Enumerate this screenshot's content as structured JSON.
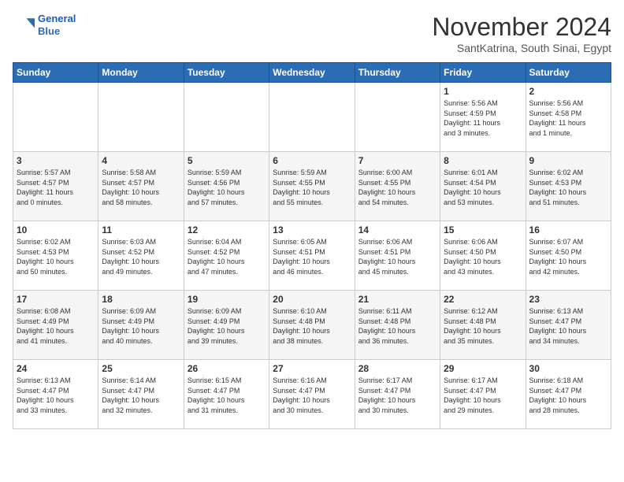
{
  "header": {
    "logo_line1": "General",
    "logo_line2": "Blue",
    "title": "November 2024",
    "subtitle": "SantKatrina, South Sinai, Egypt"
  },
  "weekdays": [
    "Sunday",
    "Monday",
    "Tuesday",
    "Wednesday",
    "Thursday",
    "Friday",
    "Saturday"
  ],
  "weeks": [
    [
      {
        "day": "",
        "info": ""
      },
      {
        "day": "",
        "info": ""
      },
      {
        "day": "",
        "info": ""
      },
      {
        "day": "",
        "info": ""
      },
      {
        "day": "",
        "info": ""
      },
      {
        "day": "1",
        "info": "Sunrise: 5:56 AM\nSunset: 4:59 PM\nDaylight: 11 hours\nand 3 minutes."
      },
      {
        "day": "2",
        "info": "Sunrise: 5:56 AM\nSunset: 4:58 PM\nDaylight: 11 hours\nand 1 minute."
      }
    ],
    [
      {
        "day": "3",
        "info": "Sunrise: 5:57 AM\nSunset: 4:57 PM\nDaylight: 11 hours\nand 0 minutes."
      },
      {
        "day": "4",
        "info": "Sunrise: 5:58 AM\nSunset: 4:57 PM\nDaylight: 10 hours\nand 58 minutes."
      },
      {
        "day": "5",
        "info": "Sunrise: 5:59 AM\nSunset: 4:56 PM\nDaylight: 10 hours\nand 57 minutes."
      },
      {
        "day": "6",
        "info": "Sunrise: 5:59 AM\nSunset: 4:55 PM\nDaylight: 10 hours\nand 55 minutes."
      },
      {
        "day": "7",
        "info": "Sunrise: 6:00 AM\nSunset: 4:55 PM\nDaylight: 10 hours\nand 54 minutes."
      },
      {
        "day": "8",
        "info": "Sunrise: 6:01 AM\nSunset: 4:54 PM\nDaylight: 10 hours\nand 53 minutes."
      },
      {
        "day": "9",
        "info": "Sunrise: 6:02 AM\nSunset: 4:53 PM\nDaylight: 10 hours\nand 51 minutes."
      }
    ],
    [
      {
        "day": "10",
        "info": "Sunrise: 6:02 AM\nSunset: 4:53 PM\nDaylight: 10 hours\nand 50 minutes."
      },
      {
        "day": "11",
        "info": "Sunrise: 6:03 AM\nSunset: 4:52 PM\nDaylight: 10 hours\nand 49 minutes."
      },
      {
        "day": "12",
        "info": "Sunrise: 6:04 AM\nSunset: 4:52 PM\nDaylight: 10 hours\nand 47 minutes."
      },
      {
        "day": "13",
        "info": "Sunrise: 6:05 AM\nSunset: 4:51 PM\nDaylight: 10 hours\nand 46 minutes."
      },
      {
        "day": "14",
        "info": "Sunrise: 6:06 AM\nSunset: 4:51 PM\nDaylight: 10 hours\nand 45 minutes."
      },
      {
        "day": "15",
        "info": "Sunrise: 6:06 AM\nSunset: 4:50 PM\nDaylight: 10 hours\nand 43 minutes."
      },
      {
        "day": "16",
        "info": "Sunrise: 6:07 AM\nSunset: 4:50 PM\nDaylight: 10 hours\nand 42 minutes."
      }
    ],
    [
      {
        "day": "17",
        "info": "Sunrise: 6:08 AM\nSunset: 4:49 PM\nDaylight: 10 hours\nand 41 minutes."
      },
      {
        "day": "18",
        "info": "Sunrise: 6:09 AM\nSunset: 4:49 PM\nDaylight: 10 hours\nand 40 minutes."
      },
      {
        "day": "19",
        "info": "Sunrise: 6:09 AM\nSunset: 4:49 PM\nDaylight: 10 hours\nand 39 minutes."
      },
      {
        "day": "20",
        "info": "Sunrise: 6:10 AM\nSunset: 4:48 PM\nDaylight: 10 hours\nand 38 minutes."
      },
      {
        "day": "21",
        "info": "Sunrise: 6:11 AM\nSunset: 4:48 PM\nDaylight: 10 hours\nand 36 minutes."
      },
      {
        "day": "22",
        "info": "Sunrise: 6:12 AM\nSunset: 4:48 PM\nDaylight: 10 hours\nand 35 minutes."
      },
      {
        "day": "23",
        "info": "Sunrise: 6:13 AM\nSunset: 4:47 PM\nDaylight: 10 hours\nand 34 minutes."
      }
    ],
    [
      {
        "day": "24",
        "info": "Sunrise: 6:13 AM\nSunset: 4:47 PM\nDaylight: 10 hours\nand 33 minutes."
      },
      {
        "day": "25",
        "info": "Sunrise: 6:14 AM\nSunset: 4:47 PM\nDaylight: 10 hours\nand 32 minutes."
      },
      {
        "day": "26",
        "info": "Sunrise: 6:15 AM\nSunset: 4:47 PM\nDaylight: 10 hours\nand 31 minutes."
      },
      {
        "day": "27",
        "info": "Sunrise: 6:16 AM\nSunset: 4:47 PM\nDaylight: 10 hours\nand 30 minutes."
      },
      {
        "day": "28",
        "info": "Sunrise: 6:17 AM\nSunset: 4:47 PM\nDaylight: 10 hours\nand 30 minutes."
      },
      {
        "day": "29",
        "info": "Sunrise: 6:17 AM\nSunset: 4:47 PM\nDaylight: 10 hours\nand 29 minutes."
      },
      {
        "day": "30",
        "info": "Sunrise: 6:18 AM\nSunset: 4:47 PM\nDaylight: 10 hours\nand 28 minutes."
      }
    ]
  ]
}
